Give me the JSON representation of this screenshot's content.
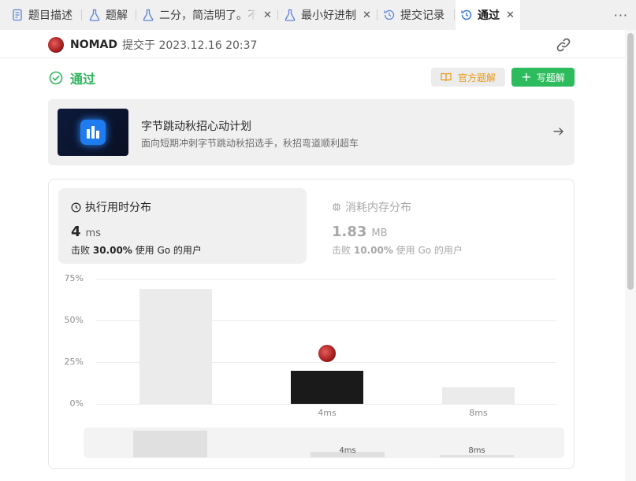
{
  "tabs": [
    {
      "label": "题目描述",
      "icon": "document-icon"
    },
    {
      "label": "题解",
      "icon": "flask-icon"
    },
    {
      "label": "二分，简洁明了。不",
      "icon": "flask-icon",
      "closable": true
    },
    {
      "label": "最小好进制",
      "icon": "flask-icon",
      "closable": true
    },
    {
      "label": "提交记录",
      "icon": "history-icon"
    },
    {
      "label": "通过",
      "icon": "history-icon",
      "closable": true,
      "active": true
    }
  ],
  "more_label": "···",
  "submission": {
    "username": "NOMAD",
    "submitted_at": "提交于 2023.12.16 20:37"
  },
  "status": {
    "text": "通过",
    "color": "#2db55d"
  },
  "actions": {
    "official_label": "官方题解",
    "write_label": "写题解",
    "write_plus": "+"
  },
  "banner": {
    "title": "字节跳动秋招心动计划",
    "subtitle": "面向短期冲刺字节跳动秋招选手，秋招弯道顺利超车"
  },
  "runtime": {
    "title": "执行用时分布",
    "value": "4",
    "unit": "ms",
    "beat_prefix": "击败",
    "beat_pct": "30.00%",
    "beat_suffix": "使用 Go 的用户"
  },
  "memory": {
    "title": "消耗内存分布",
    "value": "1.83",
    "unit": "MB",
    "beat_prefix": "击败",
    "beat_pct": "10.00%",
    "beat_suffix": "使用 Go 的用户"
  },
  "chart_data": {
    "type": "bar",
    "categories": [
      "",
      "4ms",
      "8ms"
    ],
    "values": [
      69,
      20,
      10
    ],
    "highlight_index": 1,
    "ylim": [
      0,
      75
    ],
    "yticks": [
      "0%",
      "25%",
      "50%",
      "75%"
    ],
    "ytick_values": [
      0,
      25,
      50,
      75
    ],
    "colors": {
      "normal": "#ebebeb",
      "highlight": "#1a1a1a"
    }
  },
  "overview": {
    "labels": [
      "",
      "4ms",
      "8ms"
    ]
  }
}
